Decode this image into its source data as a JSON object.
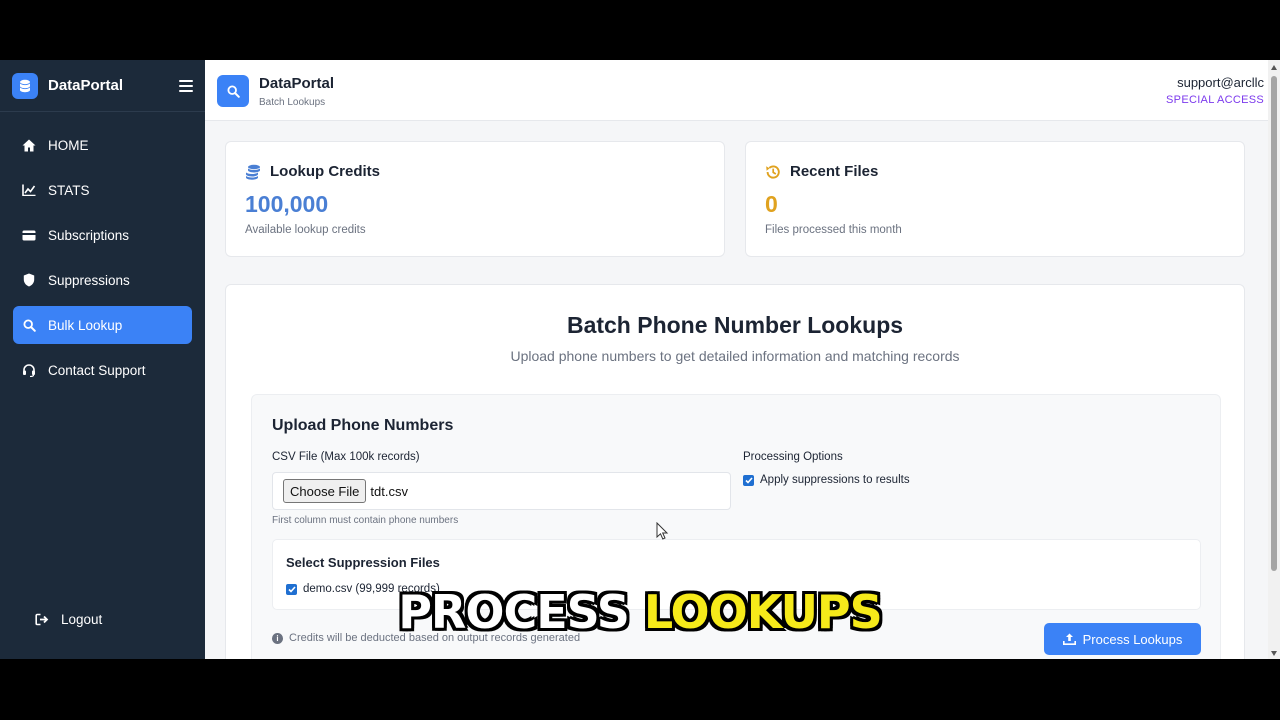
{
  "sidebar": {
    "app_name": "DataPortal",
    "items": [
      {
        "label": "HOME",
        "icon": "home-icon"
      },
      {
        "label": "STATS",
        "icon": "chart-line-icon"
      },
      {
        "label": "Subscriptions",
        "icon": "credit-card-icon"
      },
      {
        "label": "Suppressions",
        "icon": "shield-icon"
      },
      {
        "label": "Bulk Lookup",
        "icon": "search-icon",
        "active": true
      },
      {
        "label": "Contact Support",
        "icon": "headset-icon"
      }
    ],
    "logout_label": "Logout"
  },
  "header": {
    "title": "DataPortal",
    "subtitle": "Batch Lookups",
    "user": "support@arcllc",
    "role": "SPECIAL ACCESS"
  },
  "stats": {
    "credits": {
      "title": "Lookup Credits",
      "value": "100,000",
      "desc": "Available lookup credits",
      "color": "#4a7fd4"
    },
    "recent": {
      "title": "Recent Files",
      "value": "0",
      "desc": "Files processed this month",
      "color": "#e0a21f"
    }
  },
  "main": {
    "title": "Batch Phone Number Lookups",
    "subtitle": "Upload phone numbers to get detailed information and matching records"
  },
  "upload": {
    "title": "Upload Phone Numbers",
    "csv_label": "CSV File (Max 100k records)",
    "choose_file_label": "Choose File",
    "file_name": "tdt.csv",
    "hint": "First column must contain phone numbers",
    "options_label": "Processing Options",
    "apply_suppressions_label": "Apply suppressions to results",
    "apply_suppressions_checked": true,
    "suppression_title": "Select Suppression Files",
    "suppression_file": "demo.csv (99,999 records)",
    "suppression_checked": true,
    "credit_note": "Credits will be deducted based on output records generated",
    "process_label": "Process Lookups"
  },
  "caption": {
    "word1": "PROCESS",
    "word2": "LOOKUPS"
  },
  "colors": {
    "sidebar_bg": "#1c2a3a",
    "accent": "#3b82f6",
    "role": "#7c3aed"
  }
}
